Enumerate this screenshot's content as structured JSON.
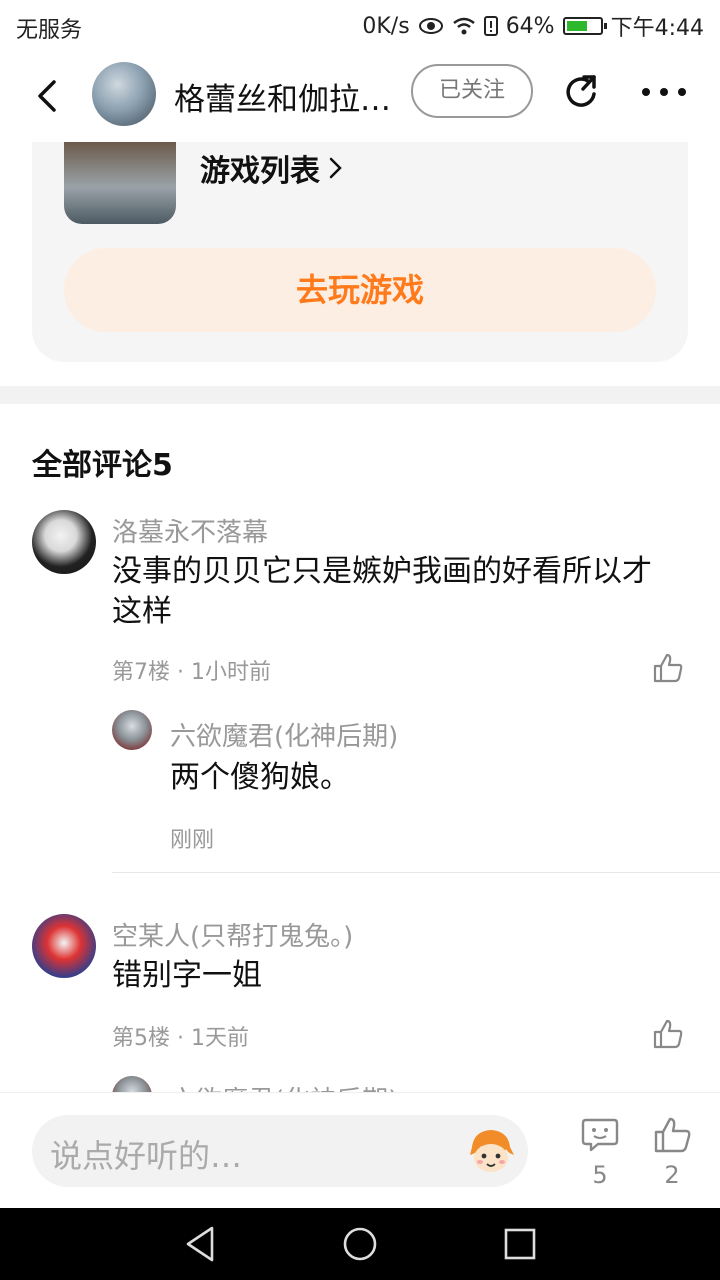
{
  "status_bar": {
    "carrier": "无服务",
    "speed": "0K/s",
    "battery_pct": "64%",
    "battery_level": 0.64,
    "time": "下午4:44"
  },
  "header": {
    "title": "格蕾丝和伽拉…",
    "follow_label": "已关注"
  },
  "game_card": {
    "list_link": "游戏列表",
    "play_label": "去玩游戏"
  },
  "comments": {
    "title": "全部评论5",
    "items": [
      {
        "user": "洛墓永不落幕",
        "text_line1": "没事的贝贝它只是嫉妒我画的好看所以才",
        "text_line2": "这样",
        "meta": "第7楼 · 1小时前",
        "reply": {
          "user": "六欲魔君(化神后期)",
          "text": "两个傻狗娘。",
          "time": "刚刚"
        }
      },
      {
        "user": "空某人(只帮打鬼兔。)",
        "text": "错别字一姐",
        "meta": "第5楼 · 1天前",
        "reply_user_partial": "六欲魔君(化神后期)"
      }
    ]
  },
  "bottom_bar": {
    "input_placeholder": "说点好听的…",
    "comment_count": "5",
    "like_count": "2"
  },
  "colors": {
    "accent": "#ff7a1a",
    "accent_bg": "#fdeee3",
    "card_bg": "#f5f5f5",
    "meta_text": "#999999"
  }
}
